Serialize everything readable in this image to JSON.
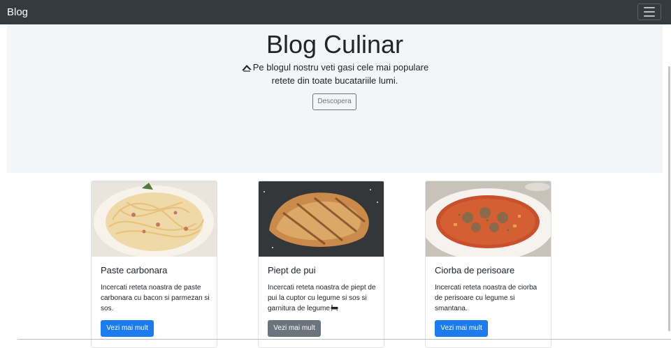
{
  "navbar": {
    "brand": "Blog",
    "toggler_icon": "hamburger-menu-icon"
  },
  "hero": {
    "title": "Blog Culinar",
    "lead_icon": "cooking-hat-icon",
    "lead": "Pe blogul nostru veti gasi cele mai populare retete din toate bucatariile lumi.",
    "button_label": "Descopera"
  },
  "cards": [
    {
      "image": "carbonara-pasta-photo",
      "title": "Paste carbonara",
      "text": "Incercati reteta noastra de paste carbonara cu bacon si parmezan si sos.",
      "button_label": "Vezi mai mult",
      "button_style": "primary"
    },
    {
      "image": "grilled-chicken-breast-photo",
      "title": "Piept de pui",
      "text": "Incercati reteta noastra de piept de pui la cuptor cu legume si sos si garnitura de legume",
      "text_icon": "bathtub-icon",
      "button_label": "Vezi mai mult",
      "button_style": "secondary"
    },
    {
      "image": "meatball-soup-photo",
      "title": "Ciorba de perisoare",
      "text": "Incercati reteta noastra de ciorba de perisoare cu legume si smantana.",
      "button_label": "Vezi mai mult",
      "button_style": "primary"
    }
  ],
  "colors": {
    "navbar_bg": "#343a40",
    "jumbotron_bg": "#f4f5f7",
    "primary": "#1d7bf0",
    "secondary": "#6c757d"
  }
}
